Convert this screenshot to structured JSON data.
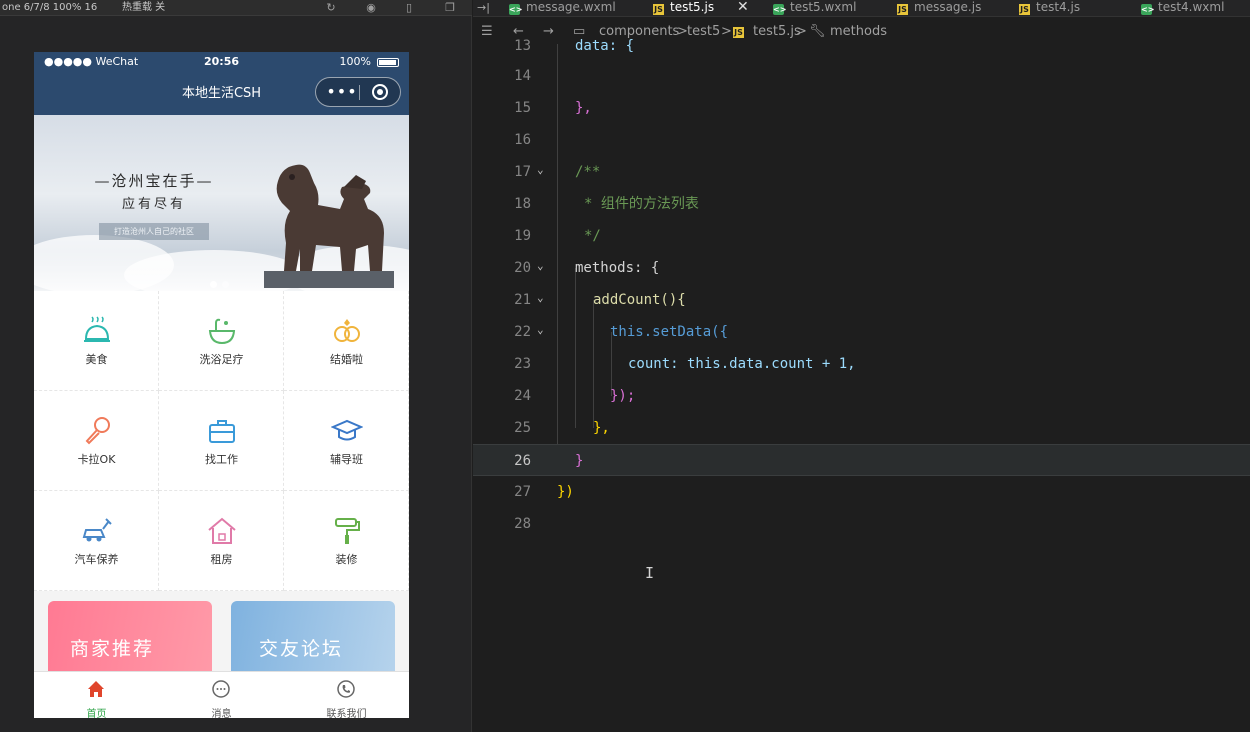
{
  "simulator": {
    "toolbar": {
      "device": "one 6/7/8 100% 16",
      "hot_reload": "热重载 关"
    },
    "status_bar": {
      "carrier": "●●●●● WeChat",
      "time": "20:56",
      "battery": "100%"
    },
    "nav_title": "本地生活CSH",
    "capsule_more": "•••",
    "banner": {
      "headline": "—沧州宝在手—",
      "subline": "应有尽有",
      "tagline": "打造沧州人自己的社区",
      "dots": 2,
      "active_dot": 0
    },
    "grid": [
      {
        "label": "美食",
        "icon": "food-cloche-icon",
        "color": "#2bb8b0"
      },
      {
        "label": "洗浴足疗",
        "icon": "bath-icon",
        "color": "#59b86a"
      },
      {
        "label": "结婚啦",
        "icon": "wedding-rings-icon",
        "color": "#f0b43c"
      },
      {
        "label": "卡拉OK",
        "icon": "microphone-icon",
        "color": "#f07a5a"
      },
      {
        "label": "找工作",
        "icon": "briefcase-icon",
        "color": "#3a9ad9"
      },
      {
        "label": "辅导班",
        "icon": "graduation-cap-icon",
        "color": "#3a78c8"
      },
      {
        "label": "汽车保养",
        "icon": "car-service-icon",
        "color": "#4a88c8"
      },
      {
        "label": "租房",
        "icon": "house-icon",
        "color": "#e07aa8"
      },
      {
        "label": "装修",
        "icon": "paint-roller-icon",
        "color": "#66b04a"
      }
    ],
    "cards": [
      {
        "label": "商家推荐"
      },
      {
        "label": "交友论坛"
      }
    ],
    "tabbar": [
      {
        "label": "首页",
        "icon": "home-icon",
        "active": true
      },
      {
        "label": "消息",
        "icon": "message-icon",
        "active": false
      },
      {
        "label": "联系我们",
        "icon": "phone-icon",
        "active": false
      }
    ]
  },
  "editor": {
    "tabs": [
      {
        "label": "message.wxml",
        "type": "wxml"
      },
      {
        "label": "test5.js",
        "type": "js",
        "active": true
      },
      {
        "label": "test5.wxml",
        "type": "wxml"
      },
      {
        "label": "message.js",
        "type": "js"
      },
      {
        "label": "test4.js",
        "type": "js"
      },
      {
        "label": "test4.wxml",
        "type": "wxml"
      }
    ],
    "breadcrumb": [
      "components",
      "test5",
      "test5.js",
      "methods"
    ],
    "current_line": 26,
    "lines": [
      {
        "n": "13",
        "text": "data: {"
      },
      {
        "n": "14",
        "text": ""
      },
      {
        "n": "15",
        "text": "},"
      },
      {
        "n": "16",
        "text": ""
      },
      {
        "n": "17",
        "text": "/**"
      },
      {
        "n": "18",
        "text": "* 组件的方法列表"
      },
      {
        "n": "19",
        "text": "*/"
      },
      {
        "n": "20",
        "text": "methods: {"
      },
      {
        "n": "21",
        "text": "addCount(){"
      },
      {
        "n": "22",
        "text": "this.setData({"
      },
      {
        "n": "23",
        "text": "count: this.data.count + 1,"
      },
      {
        "n": "24",
        "text": "});"
      },
      {
        "n": "25",
        "text": "},"
      },
      {
        "n": "26",
        "text": "}"
      },
      {
        "n": "27",
        "text": "})"
      },
      {
        "n": "28",
        "text": ""
      }
    ]
  }
}
